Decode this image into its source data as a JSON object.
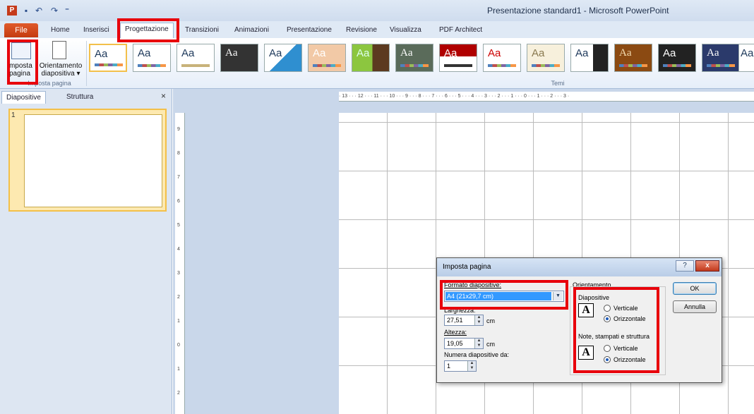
{
  "window": {
    "title": "Presentazione standard1  -  Microsoft PowerPoint",
    "icons": {
      "app": "powerpoint-logo-icon",
      "save": "save-icon",
      "undo": "undo-icon",
      "redo": "redo-icon",
      "customize": "customize-qat-icon"
    }
  },
  "ribbon_tabs": [
    "File",
    "Home",
    "Inserisci",
    "Progettazione",
    "Transizioni",
    "Animazioni",
    "Presentazione",
    "Revisione",
    "Visualizza",
    "PDF Architect"
  ],
  "selected_tab": "Progettazione",
  "ribbon": {
    "imposta_pagina": {
      "line1": "Imposta",
      "line2": "pagina"
    },
    "orientamento": {
      "line1": "Orientamento",
      "line2": "diapositiva ▾"
    },
    "group_imposta": "Imposta pagina",
    "group_temi": "Temi",
    "theme_sample": "Aa"
  },
  "left_panel": {
    "tabs": [
      "Diapositive",
      "Struttura"
    ],
    "close": "×",
    "slide_number": "1"
  },
  "ruler": {
    "horizontal": "· 13 · · · 12 · · · 11 · · · 10 · · · 9 · · · 8 · · · 7 · · · 6 · · · 5 · · · 4 · · · 3 · · · 2 · · · 1 · · · 0 · · · 1 · · · 2 · · · 3 ·",
    "vertical": [
      "9",
      "8",
      "7",
      "6",
      "5",
      "4",
      "3",
      "2",
      "1",
      "0",
      "1",
      "2"
    ]
  },
  "dialog": {
    "title": "Imposta pagina",
    "help": "?",
    "close": "x",
    "formato_label": "Formato diapositive:",
    "formato_value": "A4 (21x29,7 cm)",
    "larghezza_label": "Larghezza:",
    "larghezza_value": "27,51",
    "larghezza_unit": "cm",
    "altezza_label": "Altezza:",
    "altezza_value": "19,05",
    "altezza_unit": "cm",
    "numera_label": "Numera diapositive da:",
    "numera_value": "1",
    "orientamento_label": "Orientamento",
    "diapositive_label": "Diapositive",
    "note_label": "Note, stampati e struttura",
    "verticale": "Verticale",
    "orizzontale": "Orizzontale",
    "ok": "OK",
    "annulla": "Annulla",
    "slides_orientation": "Orizzontale",
    "notes_orientation": "Orizzontale"
  }
}
